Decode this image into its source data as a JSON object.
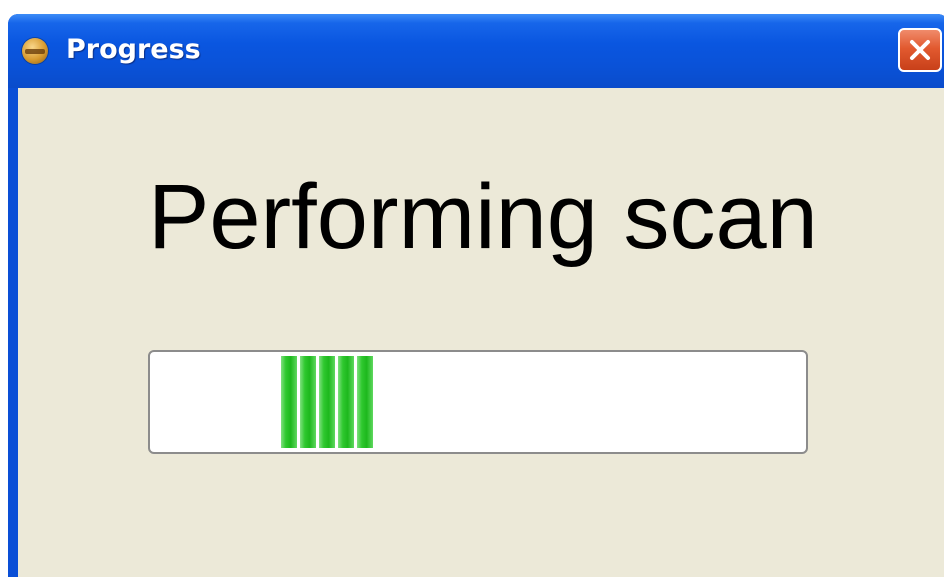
{
  "window": {
    "title": "Progress",
    "icon": "app-icon",
    "close_icon": "close-icon"
  },
  "content": {
    "heading": "Performing scan"
  },
  "progress": {
    "mode": "marquee",
    "chunk_count": 5,
    "position_fraction": 0.2,
    "chunk_color": "#22c022"
  },
  "colors": {
    "titlebar": "#0a56e0",
    "client_bg": "#ece9d8",
    "close_button": "#e25a30"
  }
}
